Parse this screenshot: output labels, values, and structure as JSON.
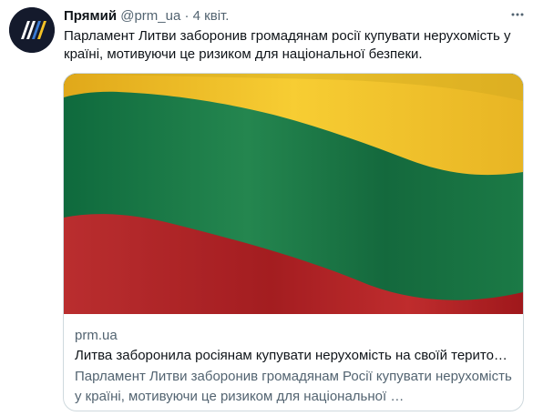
{
  "tweet": {
    "author_name": "Прямий",
    "handle": "@prm_ua",
    "separator": "·",
    "date": "4 квіт.",
    "text": "Парламент Литви заборонив громадянам росії купувати нерухомість у країні, мотивуючи це ризиком для національної безпеки.",
    "avatar_icon": "prm-logo-icon",
    "more_icon": "more-options-icon"
  },
  "card": {
    "image_alt": "lithuanian-flag-image",
    "domain": "prm.ua",
    "title": "Литва заборонила росіянам купувати нерухомість на своїй терито…",
    "description": "Парламент Литви заборонив громадянам Росії купувати нерухомість у країні, мотивуючи це ризиком для національної …"
  },
  "colors": {
    "flag_yellow": "#f5c326",
    "flag_green": "#1f7f4b",
    "flag_red": "#be2a2a",
    "avatar_bg": "#141a2c",
    "text_secondary": "#536471",
    "border": "#cfd9de"
  }
}
